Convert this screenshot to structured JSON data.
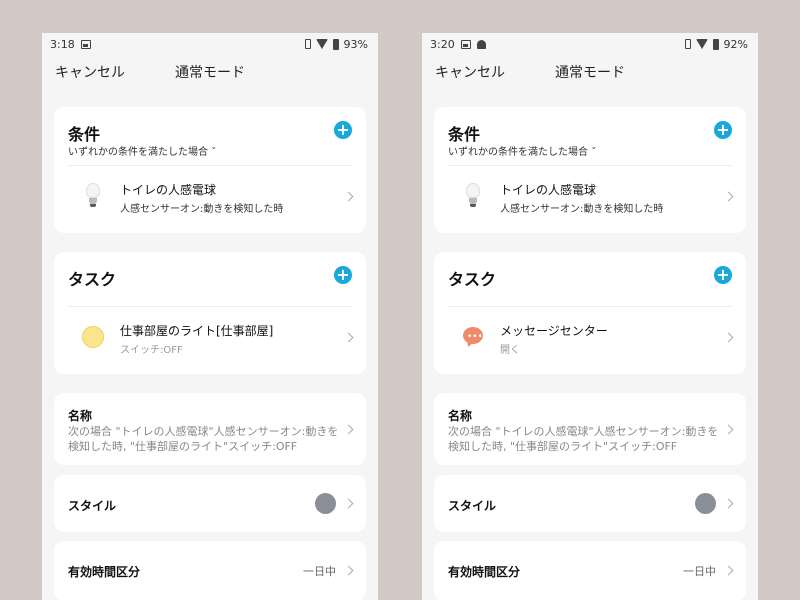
{
  "screens": [
    {
      "status": {
        "time": "3:18",
        "battery": "93%"
      },
      "nav": {
        "cancel": "キャンセル",
        "title": "通常モード"
      },
      "conditions": {
        "title": "条件",
        "subtitle": "いずれかの条件を満たした場合",
        "item": {
          "title": "トイレの人感電球",
          "detail": "人感センサーオン:動きを検知した時",
          "icon": "lightbulb-icon"
        }
      },
      "tasks": {
        "title": "タスク",
        "item": {
          "title": "仕事部屋のライト[仕事部屋]",
          "detail": "スイッチ:OFF",
          "icon": "yellow-light-icon"
        }
      },
      "name": {
        "label": "名称",
        "value": "次の場合 \"トイレの人感電球\"人感センサーオン:動きを検知した時, \"仕事部屋のライト\"スイッチ:OFF"
      },
      "style": {
        "label": "スタイル",
        "color": "#8a8e99"
      },
      "time": {
        "label": "有効時間区分",
        "value": "一日中"
      }
    },
    {
      "status": {
        "time": "3:20",
        "battery": "92%"
      },
      "nav": {
        "cancel": "キャンセル",
        "title": "通常モード"
      },
      "conditions": {
        "title": "条件",
        "subtitle": "いずれかの条件を満たした場合",
        "item": {
          "title": "トイレの人感電球",
          "detail": "人感センサーオン:動きを検知した時",
          "icon": "lightbulb-icon"
        }
      },
      "tasks": {
        "title": "タスク",
        "item": {
          "title": "メッセージセンター",
          "detail": "開く",
          "icon": "message-bubble-icon"
        }
      },
      "name": {
        "label": "名称",
        "value": "次の場合 \"トイレの人感電球\"人感センサーオン:動きを検知した時, \"仕事部屋のライト\"スイッチ:OFF"
      },
      "style": {
        "label": "スタイル",
        "color": "#8a8e99"
      },
      "time": {
        "label": "有効時間区分",
        "value": "一日中"
      }
    }
  ],
  "accent_color": "#1aa7dc"
}
